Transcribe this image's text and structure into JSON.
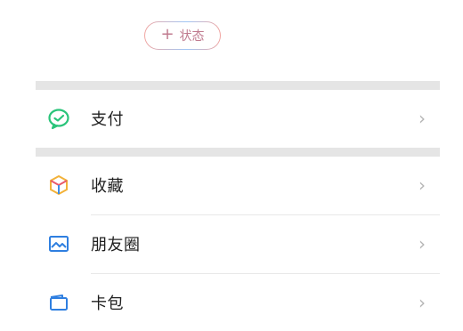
{
  "status": {
    "plus_icon": "+",
    "label": "状态"
  },
  "menu": {
    "items": [
      {
        "label": "支付",
        "icon": "wechat-pay-icon",
        "chevron": "›"
      },
      {
        "label": "收藏",
        "icon": "favorites-cube-icon",
        "chevron": "›"
      },
      {
        "label": "朋友圈",
        "icon": "moments-image-icon",
        "chevron": "›"
      },
      {
        "label": "卡包",
        "icon": "card-wallet-icon",
        "chevron": "›"
      }
    ]
  },
  "colors": {
    "pay_green": "#2ac47a",
    "favorites_orange": "#f2b23a",
    "moments_blue": "#2f7fe0",
    "card_blue": "#2f7fe0",
    "separator": "#e5e5e5"
  }
}
